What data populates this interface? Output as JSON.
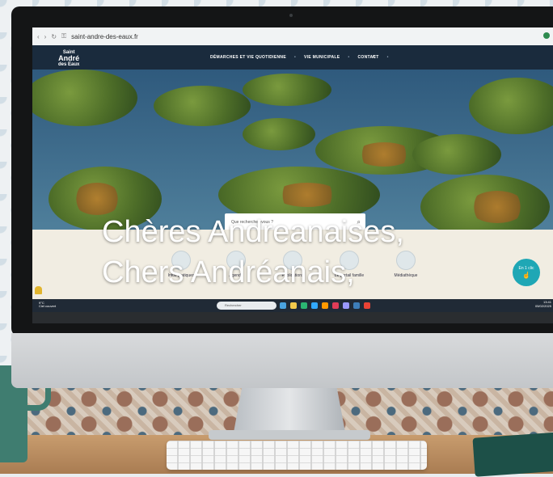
{
  "browser": {
    "url": "saint-andre-des-eaux.fr"
  },
  "site": {
    "logo_line1": "Saint",
    "logo_line2": "André",
    "logo_line3": "des Eaux",
    "nav": [
      "DÉMARCHES ET VIE QUOTIDIENNE",
      "VIE MUNICIPALE",
      "CONTACT"
    ],
    "search_placeholder": "Que recherchez-vous ?",
    "quick_links": [
      "Infos pratiques",
      "Agenda",
      "Publications",
      "Le portail famille",
      "Médiathèque"
    ],
    "cta": {
      "line1": "En 1 clic",
      "icon": "pointer-icon"
    }
  },
  "taskbar": {
    "weather_temp": "9°C",
    "weather_text": "Ciel couvert",
    "search_placeholder": "Rechercher",
    "time": "13:41",
    "date": "05/02/2025"
  },
  "headline": {
    "line1": "Chères Andreanaises,",
    "line2": "Chers Andréanais,"
  },
  "colors": {
    "site_header": "#1a2b3d",
    "accent_teal": "#1fa7b5",
    "quick_links_bg": "#f1ede2",
    "taskbar": "#202a36"
  }
}
